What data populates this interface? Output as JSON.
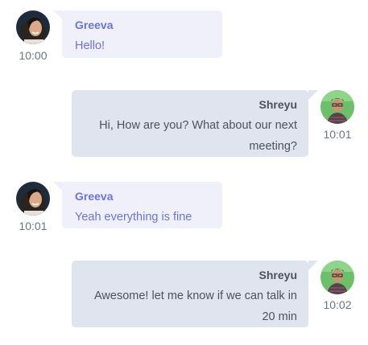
{
  "colors": {
    "incoming_bubble": "#f0f0fb",
    "outgoing_bubble": "#dfe4ef",
    "incoming_text": "#6c73e0",
    "outgoing_text": "#4c535c",
    "time_text": "#6c757d"
  },
  "messages": [
    {
      "sender": "Greeva",
      "text": "Hello!",
      "time": "10:00",
      "direction": "incoming",
      "avatar_icon": "greeva-avatar"
    },
    {
      "sender": "Shreyu",
      "text_lines": [
        "Hi, How are you? What about our next",
        "meeting?"
      ],
      "time": "10:01",
      "direction": "outgoing",
      "avatar_icon": "shreyu-avatar"
    },
    {
      "sender": "Greeva",
      "text": "Yeah everything is fine",
      "time": "10:01",
      "direction": "incoming",
      "avatar_icon": "greeva-avatar"
    },
    {
      "sender": "Shreyu",
      "text_lines": [
        "Awesome! let me know if we can talk in",
        "20 min"
      ],
      "time": "10:02",
      "direction": "outgoing",
      "avatar_icon": "shreyu-avatar"
    }
  ]
}
